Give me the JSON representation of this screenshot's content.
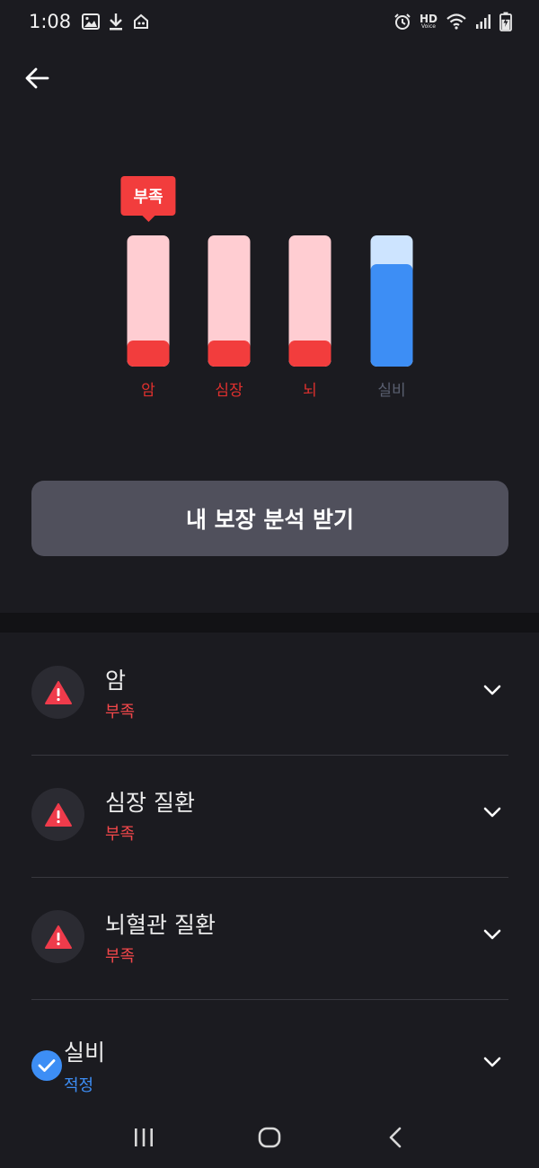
{
  "status_bar": {
    "time": "1:08",
    "hd": "HD",
    "voice": "Voice",
    "battery_level": 0.7
  },
  "colors": {
    "background": "#1b1b20",
    "danger": "#f23d3d",
    "danger_track": "#ffcdd2",
    "ok": "#3d8ef5",
    "ok_track": "#cde4ff",
    "button": "#50505c"
  },
  "chart_data": {
    "type": "bar",
    "categories": [
      "암",
      "심장",
      "뇌",
      "실비"
    ],
    "values": [
      0.2,
      0.2,
      0.2,
      0.78
    ],
    "ylim": [
      0,
      1
    ],
    "status": [
      "부족",
      "부족",
      "부족",
      "적정"
    ],
    "highlight_tooltip": {
      "index": 0,
      "label": "부족"
    },
    "label_colors": [
      "#e0302e",
      "#e0302e",
      "#e0302e",
      "#5a5f70"
    ]
  },
  "cta": {
    "label": "내 보장 분석 받기"
  },
  "coverage": [
    {
      "title": "암",
      "status": "부족",
      "kind": "warning"
    },
    {
      "title": "심장 질환",
      "status": "부족",
      "kind": "warning"
    },
    {
      "title": "뇌혈관 질환",
      "status": "부족",
      "kind": "warning"
    },
    {
      "title": "실비",
      "status": "적정",
      "kind": "ok"
    }
  ],
  "icons": {
    "back": "arrow-left-icon",
    "warning": "warning-triangle-icon",
    "check": "check-icon",
    "expand": "chevron-down-icon",
    "nav": [
      "recent-apps-icon",
      "home-icon",
      "back-nav-icon"
    ]
  }
}
